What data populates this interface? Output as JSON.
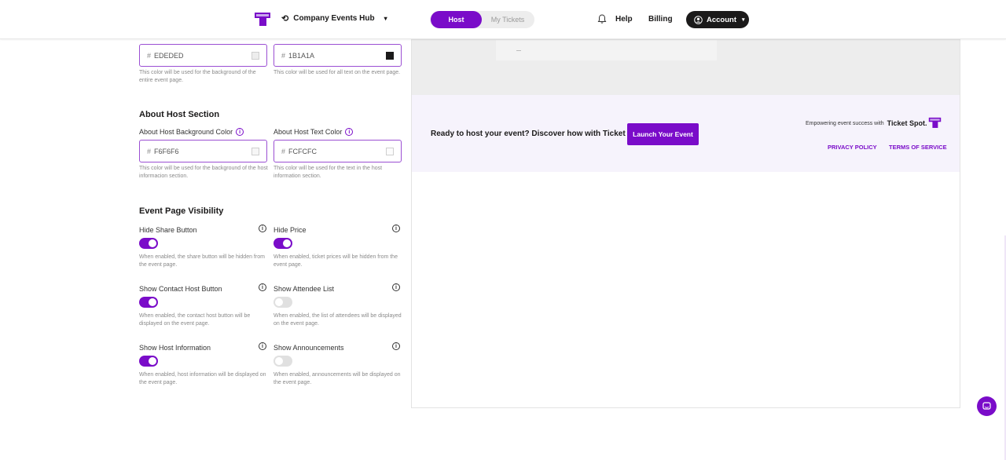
{
  "nav": {
    "workspace_label": "Company Events Hub",
    "host_tab": "Host",
    "my_tickets_tab": "My Tickets",
    "help": "Help",
    "billing": "Billing",
    "account": "Account"
  },
  "colors_top": {
    "background": {
      "value": "EDEDED",
      "helper": "This color will be used for the background of the entire event page."
    },
    "text": {
      "value": "1B1A1A",
      "helper": "This color will be used for all text on the event page."
    }
  },
  "about_host": {
    "title": "About Host Section",
    "bg_label": "About Host Background Color",
    "bg_value": "F6F6F6",
    "bg_helper": "This color will be used for the background of the host informacion section.",
    "text_label": "About Host Text Color",
    "text_value": "FCFCFC",
    "text_helper": "This color will be used for the text in the host information section."
  },
  "visibility": {
    "title": "Event Page Visibility",
    "items": [
      {
        "label": "Hide Share Button",
        "on": true,
        "helper": "When enabled, the share button will be hidden from the event page."
      },
      {
        "label": "Hide Price",
        "on": true,
        "helper": "When enabled, ticket prices will be hidden from the event page."
      },
      {
        "label": "Show Contact Host Button",
        "on": true,
        "helper": "When enabled, the contact host button will be displayed on the event page."
      },
      {
        "label": "Show Attendee List",
        "on": false,
        "helper": "When enabled, the list of attendees will be displayed on the event page."
      },
      {
        "label": "Show Host Information",
        "on": true,
        "helper": "When enabled, host information will be displayed on the event page."
      },
      {
        "label": "Show Announcements",
        "on": false,
        "helper": "When enabled, announcements will be displayed on the event page."
      }
    ]
  },
  "preview": {
    "cta_text": "Ready to host your event? Discover how with Ticket Spot.",
    "launch_button": "Launch Your Event",
    "empowering": "Empowering event success with",
    "brand": "Ticket Spot.",
    "privacy": "PRIVACY POLICY",
    "terms": "TERMS OF SERVICE"
  },
  "theme": {
    "accent": "#7a0cc9",
    "dark": "#1b1a1a",
    "page_bg": "#ededed",
    "footer_bg": "#f6f3fc"
  }
}
